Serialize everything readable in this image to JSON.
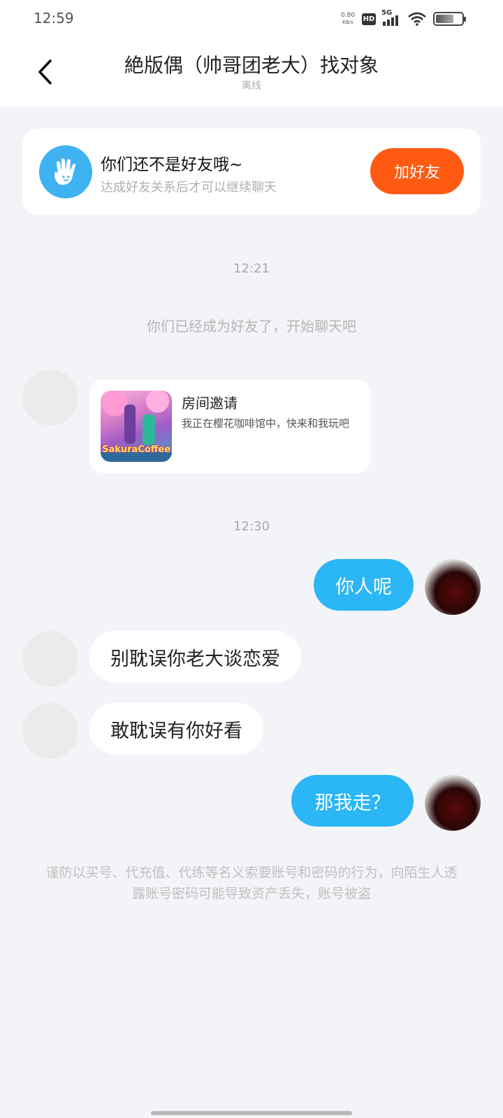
{
  "status_bar": {
    "time": "12:59",
    "net_speed_value": "0.80",
    "net_speed_unit": "KB/s",
    "hd_label": "HD",
    "network_label": "5G",
    "battery_icon": "battery-icon",
    "wifi_icon": "wifi-icon"
  },
  "header": {
    "back_icon": "chevron-left-icon",
    "title": "絶版偶（帅哥团老大）找对象",
    "status": "离线"
  },
  "friend_prompt": {
    "icon": "waving-hand-icon",
    "title": "你们还不是好友哦~",
    "subtitle": "达成好友关系后才可以继续聊天",
    "button_label": "加好友",
    "button_color": "#ff5a12"
  },
  "messages": {
    "time_1": "12:21",
    "system_text": "你们已经成为好友了，开始聊天吧",
    "invite": {
      "title": "房间邀请",
      "description": "我正在樱花咖啡馆中，快来和我玩吧",
      "thumbnail_text": "SakuraCoffee"
    },
    "time_2": "12:30",
    "msg_1": "你人呢",
    "msg_2": "别耽误你老大谈恋爱",
    "msg_3": "敢耽误有你好看",
    "msg_4": "那我走？"
  },
  "notice": "谨防以买号、代充值、代练等名义索要账号和密码的行为，向陌生人透露账号密码可能导致资产丢失，账号被盗",
  "colors": {
    "bubble_self": "#2bb6f6",
    "background": "#f3f4f8"
  }
}
